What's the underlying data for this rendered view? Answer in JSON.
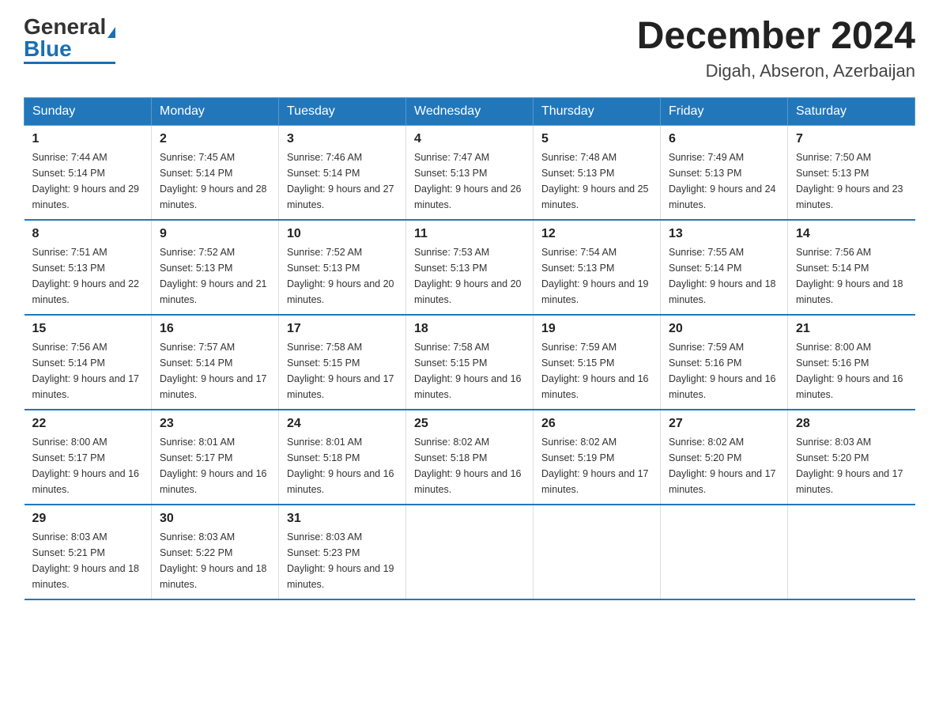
{
  "header": {
    "logo_general": "General",
    "logo_blue": "Blue",
    "month_title": "December 2024",
    "location": "Digah, Abseron, Azerbaijan"
  },
  "days_of_week": [
    "Sunday",
    "Monday",
    "Tuesday",
    "Wednesday",
    "Thursday",
    "Friday",
    "Saturday"
  ],
  "weeks": [
    [
      {
        "day": "1",
        "sunrise": "7:44 AM",
        "sunset": "5:14 PM",
        "daylight": "9 hours and 29 minutes."
      },
      {
        "day": "2",
        "sunrise": "7:45 AM",
        "sunset": "5:14 PM",
        "daylight": "9 hours and 28 minutes."
      },
      {
        "day": "3",
        "sunrise": "7:46 AM",
        "sunset": "5:14 PM",
        "daylight": "9 hours and 27 minutes."
      },
      {
        "day": "4",
        "sunrise": "7:47 AM",
        "sunset": "5:13 PM",
        "daylight": "9 hours and 26 minutes."
      },
      {
        "day": "5",
        "sunrise": "7:48 AM",
        "sunset": "5:13 PM",
        "daylight": "9 hours and 25 minutes."
      },
      {
        "day": "6",
        "sunrise": "7:49 AM",
        "sunset": "5:13 PM",
        "daylight": "9 hours and 24 minutes."
      },
      {
        "day": "7",
        "sunrise": "7:50 AM",
        "sunset": "5:13 PM",
        "daylight": "9 hours and 23 minutes."
      }
    ],
    [
      {
        "day": "8",
        "sunrise": "7:51 AM",
        "sunset": "5:13 PM",
        "daylight": "9 hours and 22 minutes."
      },
      {
        "day": "9",
        "sunrise": "7:52 AM",
        "sunset": "5:13 PM",
        "daylight": "9 hours and 21 minutes."
      },
      {
        "day": "10",
        "sunrise": "7:52 AM",
        "sunset": "5:13 PM",
        "daylight": "9 hours and 20 minutes."
      },
      {
        "day": "11",
        "sunrise": "7:53 AM",
        "sunset": "5:13 PM",
        "daylight": "9 hours and 20 minutes."
      },
      {
        "day": "12",
        "sunrise": "7:54 AM",
        "sunset": "5:13 PM",
        "daylight": "9 hours and 19 minutes."
      },
      {
        "day": "13",
        "sunrise": "7:55 AM",
        "sunset": "5:14 PM",
        "daylight": "9 hours and 18 minutes."
      },
      {
        "day": "14",
        "sunrise": "7:56 AM",
        "sunset": "5:14 PM",
        "daylight": "9 hours and 18 minutes."
      }
    ],
    [
      {
        "day": "15",
        "sunrise": "7:56 AM",
        "sunset": "5:14 PM",
        "daylight": "9 hours and 17 minutes."
      },
      {
        "day": "16",
        "sunrise": "7:57 AM",
        "sunset": "5:14 PM",
        "daylight": "9 hours and 17 minutes."
      },
      {
        "day": "17",
        "sunrise": "7:58 AM",
        "sunset": "5:15 PM",
        "daylight": "9 hours and 17 minutes."
      },
      {
        "day": "18",
        "sunrise": "7:58 AM",
        "sunset": "5:15 PM",
        "daylight": "9 hours and 16 minutes."
      },
      {
        "day": "19",
        "sunrise": "7:59 AM",
        "sunset": "5:15 PM",
        "daylight": "9 hours and 16 minutes."
      },
      {
        "day": "20",
        "sunrise": "7:59 AM",
        "sunset": "5:16 PM",
        "daylight": "9 hours and 16 minutes."
      },
      {
        "day": "21",
        "sunrise": "8:00 AM",
        "sunset": "5:16 PM",
        "daylight": "9 hours and 16 minutes."
      }
    ],
    [
      {
        "day": "22",
        "sunrise": "8:00 AM",
        "sunset": "5:17 PM",
        "daylight": "9 hours and 16 minutes."
      },
      {
        "day": "23",
        "sunrise": "8:01 AM",
        "sunset": "5:17 PM",
        "daylight": "9 hours and 16 minutes."
      },
      {
        "day": "24",
        "sunrise": "8:01 AM",
        "sunset": "5:18 PM",
        "daylight": "9 hours and 16 minutes."
      },
      {
        "day": "25",
        "sunrise": "8:02 AM",
        "sunset": "5:18 PM",
        "daylight": "9 hours and 16 minutes."
      },
      {
        "day": "26",
        "sunrise": "8:02 AM",
        "sunset": "5:19 PM",
        "daylight": "9 hours and 17 minutes."
      },
      {
        "day": "27",
        "sunrise": "8:02 AM",
        "sunset": "5:20 PM",
        "daylight": "9 hours and 17 minutes."
      },
      {
        "day": "28",
        "sunrise": "8:03 AM",
        "sunset": "5:20 PM",
        "daylight": "9 hours and 17 minutes."
      }
    ],
    [
      {
        "day": "29",
        "sunrise": "8:03 AM",
        "sunset": "5:21 PM",
        "daylight": "9 hours and 18 minutes."
      },
      {
        "day": "30",
        "sunrise": "8:03 AM",
        "sunset": "5:22 PM",
        "daylight": "9 hours and 18 minutes."
      },
      {
        "day": "31",
        "sunrise": "8:03 AM",
        "sunset": "5:23 PM",
        "daylight": "9 hours and 19 minutes."
      },
      {
        "day": "",
        "sunrise": "",
        "sunset": "",
        "daylight": ""
      },
      {
        "day": "",
        "sunrise": "",
        "sunset": "",
        "daylight": ""
      },
      {
        "day": "",
        "sunrise": "",
        "sunset": "",
        "daylight": ""
      },
      {
        "day": "",
        "sunrise": "",
        "sunset": "",
        "daylight": ""
      }
    ]
  ]
}
